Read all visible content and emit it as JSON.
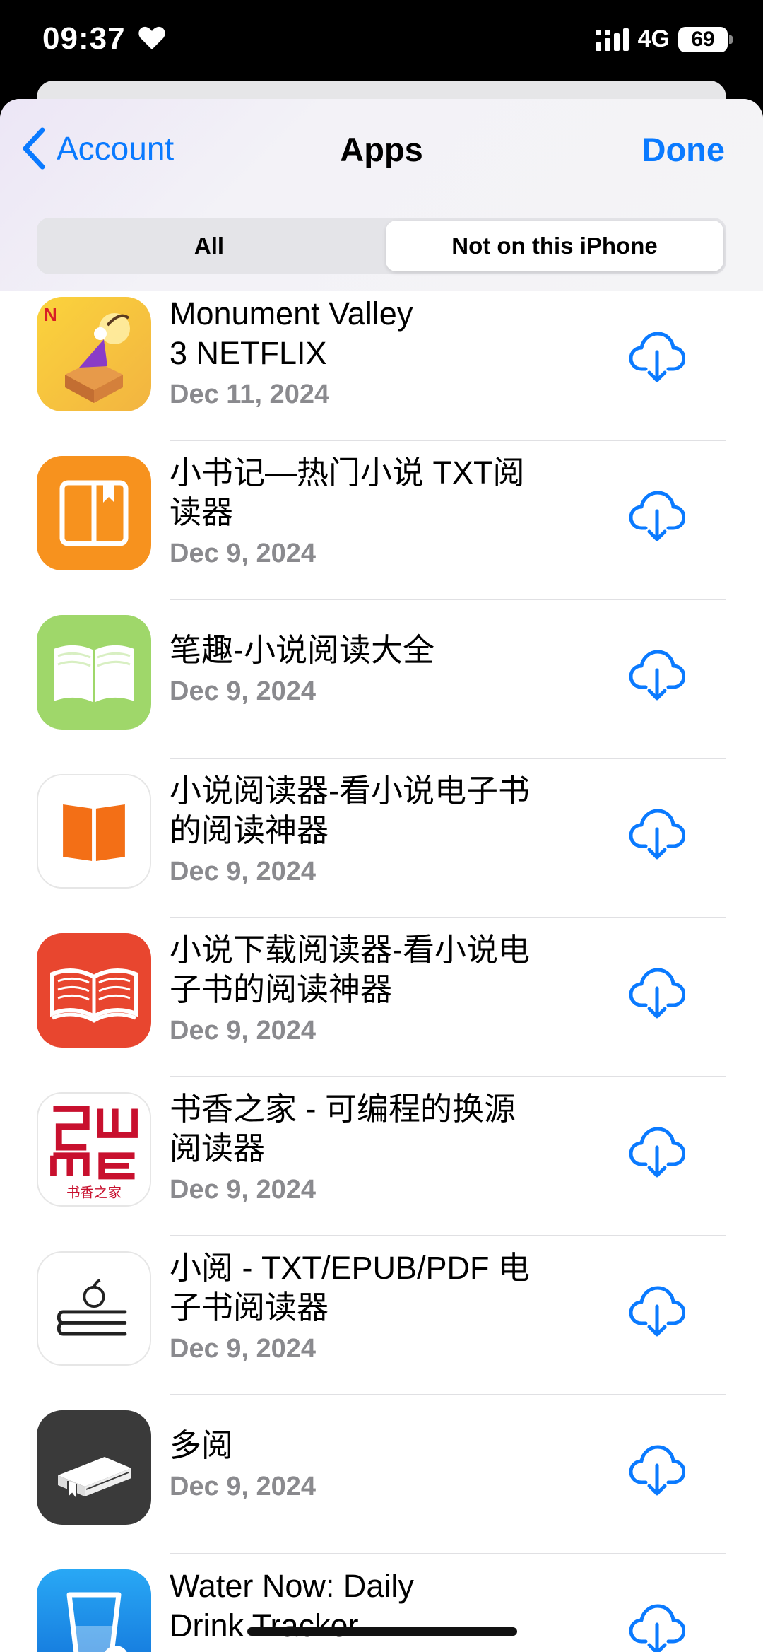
{
  "status": {
    "time": "09:37",
    "network": "4G",
    "battery": "69"
  },
  "nav": {
    "back_label": "Account",
    "title": "Apps",
    "done_label": "Done"
  },
  "segments": {
    "all": "All",
    "not_on_device": "Not on this iPhone",
    "selected": "not_on_device"
  },
  "colors": {
    "accent": "#0a7aff",
    "secondary_text": "#8a8a8e"
  },
  "apps": [
    {
      "name_lines": [
        "Monument Valley",
        "3 NETFLIX"
      ],
      "date": "Dec 11, 2024",
      "icon": "monument-valley-icon"
    },
    {
      "name_lines": [
        "小书记—热门小说 TXT阅",
        "读器"
      ],
      "date": "Dec 9, 2024",
      "icon": "book-orange-icon"
    },
    {
      "name_lines": [
        "笔趣-小说阅读大全"
      ],
      "date": "Dec 9, 2024",
      "icon": "book-green-icon"
    },
    {
      "name_lines": [
        "小说阅读器-看小说电子书",
        "的阅读神器"
      ],
      "date": "Dec 9, 2024",
      "icon": "book-white-icon"
    },
    {
      "name_lines": [
        "小说下载阅读器-看小说电",
        "子书的阅读神器"
      ],
      "date": "Dec 9, 2024",
      "icon": "book-red-icon"
    },
    {
      "name_lines": [
        "书香之家 - 可编程的换源",
        "阅读器"
      ],
      "date": "Dec 9, 2024",
      "icon": "shuxiang-icon",
      "icon_text": "书香之家"
    },
    {
      "name_lines": [
        "小阅 - TXT/EPUB/PDF 电",
        "子书阅读器"
      ],
      "date": "Dec 9, 2024",
      "icon": "apple-reader-icon"
    },
    {
      "name_lines": [
        "多阅"
      ],
      "date": "Dec 9, 2024",
      "icon": "book-dark-icon"
    },
    {
      "name_lines": [
        "Water Now: Daily",
        "Drink Tracker"
      ],
      "date": "",
      "icon": "water-glass-icon"
    }
  ]
}
